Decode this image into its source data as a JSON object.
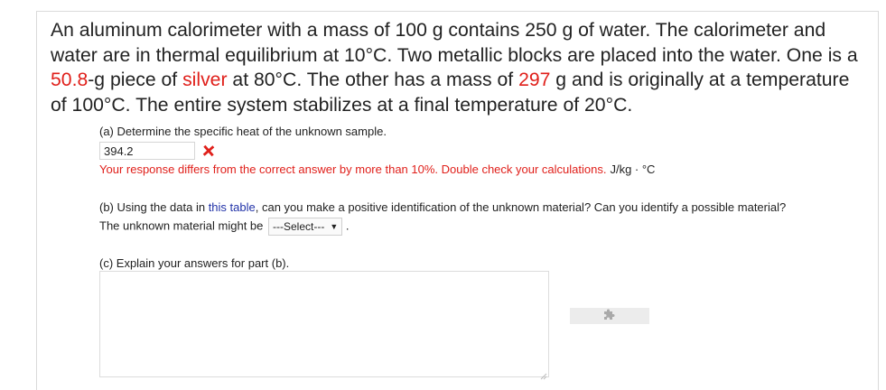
{
  "problem": {
    "t1": "An aluminum calorimeter with a mass of 100 g contains 250 g of water. The calorimeter and water are in thermal equilibrium at 10°C. Two metallic blocks are placed into the water. One is a ",
    "mass_silver": "50.8",
    "t2": "-g piece of ",
    "material": "silver",
    "t3": " at 80°C. The other has a mass of ",
    "mass_unknown": "297",
    "t4": " g and is originally at a temperature of 100°C. The entire system stabilizes at a final temperature of 20°C."
  },
  "part_a": {
    "question": "(a) Determine the specific heat of the unknown sample.",
    "answer_value": "394.2",
    "feedback": "Your response differs from the correct answer by more than 10%. Double check your calculations.",
    "units": "J/kg · °C"
  },
  "part_b": {
    "q1": "(b) Using the data in ",
    "link_text": "this table",
    "q2": ", can you make a positive identification of the unknown material? Can you identify a possible material?",
    "line2": "The unknown material might be",
    "select_value": "---Select---",
    "period": "."
  },
  "part_c": {
    "question": "(c) Explain your answers for part (b)."
  },
  "icons": {
    "wrong": "x-icon",
    "plugin": "puzzle-icon",
    "caret": "caret-down-icon"
  },
  "colors": {
    "wrong": "#e0201b",
    "link": "#2233a8"
  }
}
